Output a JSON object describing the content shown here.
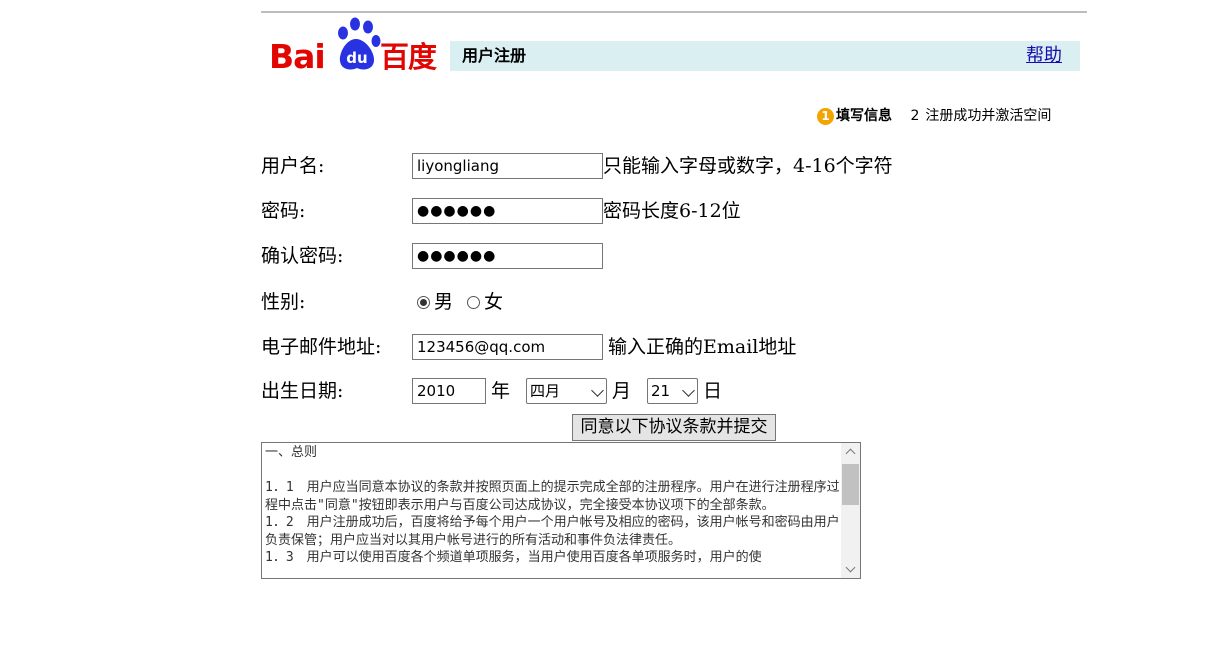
{
  "logo": {
    "bai_text": "Bai",
    "du_text": "du",
    "cn_text": "百度"
  },
  "header": {
    "title": "用户注册",
    "help_link": "帮助"
  },
  "steps": {
    "step1_number": "1",
    "step1_label": "填写信息",
    "step2_number": "2",
    "step2_label": "注册成功并激活空间"
  },
  "form": {
    "username": {
      "label": "用户名:",
      "value": "liyongliang",
      "hint": "只能输入字母或数字，4-16个字符"
    },
    "password": {
      "label": "密码:",
      "value": "●●●●●●",
      "hint": "密码长度6-12位"
    },
    "confirm_password": {
      "label": "确认密码:",
      "value": "●●●●●●"
    },
    "gender": {
      "label": "性别:",
      "options": [
        "男",
        "女"
      ],
      "selected": "男"
    },
    "email": {
      "label": "电子邮件地址:",
      "value": "123456@qq.com",
      "hint": "输入正确的Email地址"
    },
    "birthdate": {
      "label": "出生日期:",
      "year": "2010",
      "year_unit": "年",
      "month": "四月",
      "month_unit": "月",
      "day": "21",
      "day_unit": "日"
    },
    "submit_label": "同意以下协议条款并提交"
  },
  "terms": {
    "text": "一、总则\n\n1．1　用户应当同意本协议的条款并按照页面上的提示完成全部的注册程序。用户在进行注册程序过程中点击\"同意\"按钮即表示用户与百度公司达成协议，完全接受本协议项下的全部条款。\n1．2　用户注册成功后，百度将给予每个用户一个用户帐号及相应的密码，该用户帐号和密码由用户负责保管；用户应当对以其用户帐号进行的所有活动和事件负法律责任。\n1．3　用户可以使用百度各个频道单项服务，当用户使用百度各单项服务时，用户的使"
  },
  "colors": {
    "brand_red": "#e10601",
    "brand_blue": "#2932e1",
    "title_bar": "#d9eff2",
    "step_badge": "#f4a400"
  }
}
